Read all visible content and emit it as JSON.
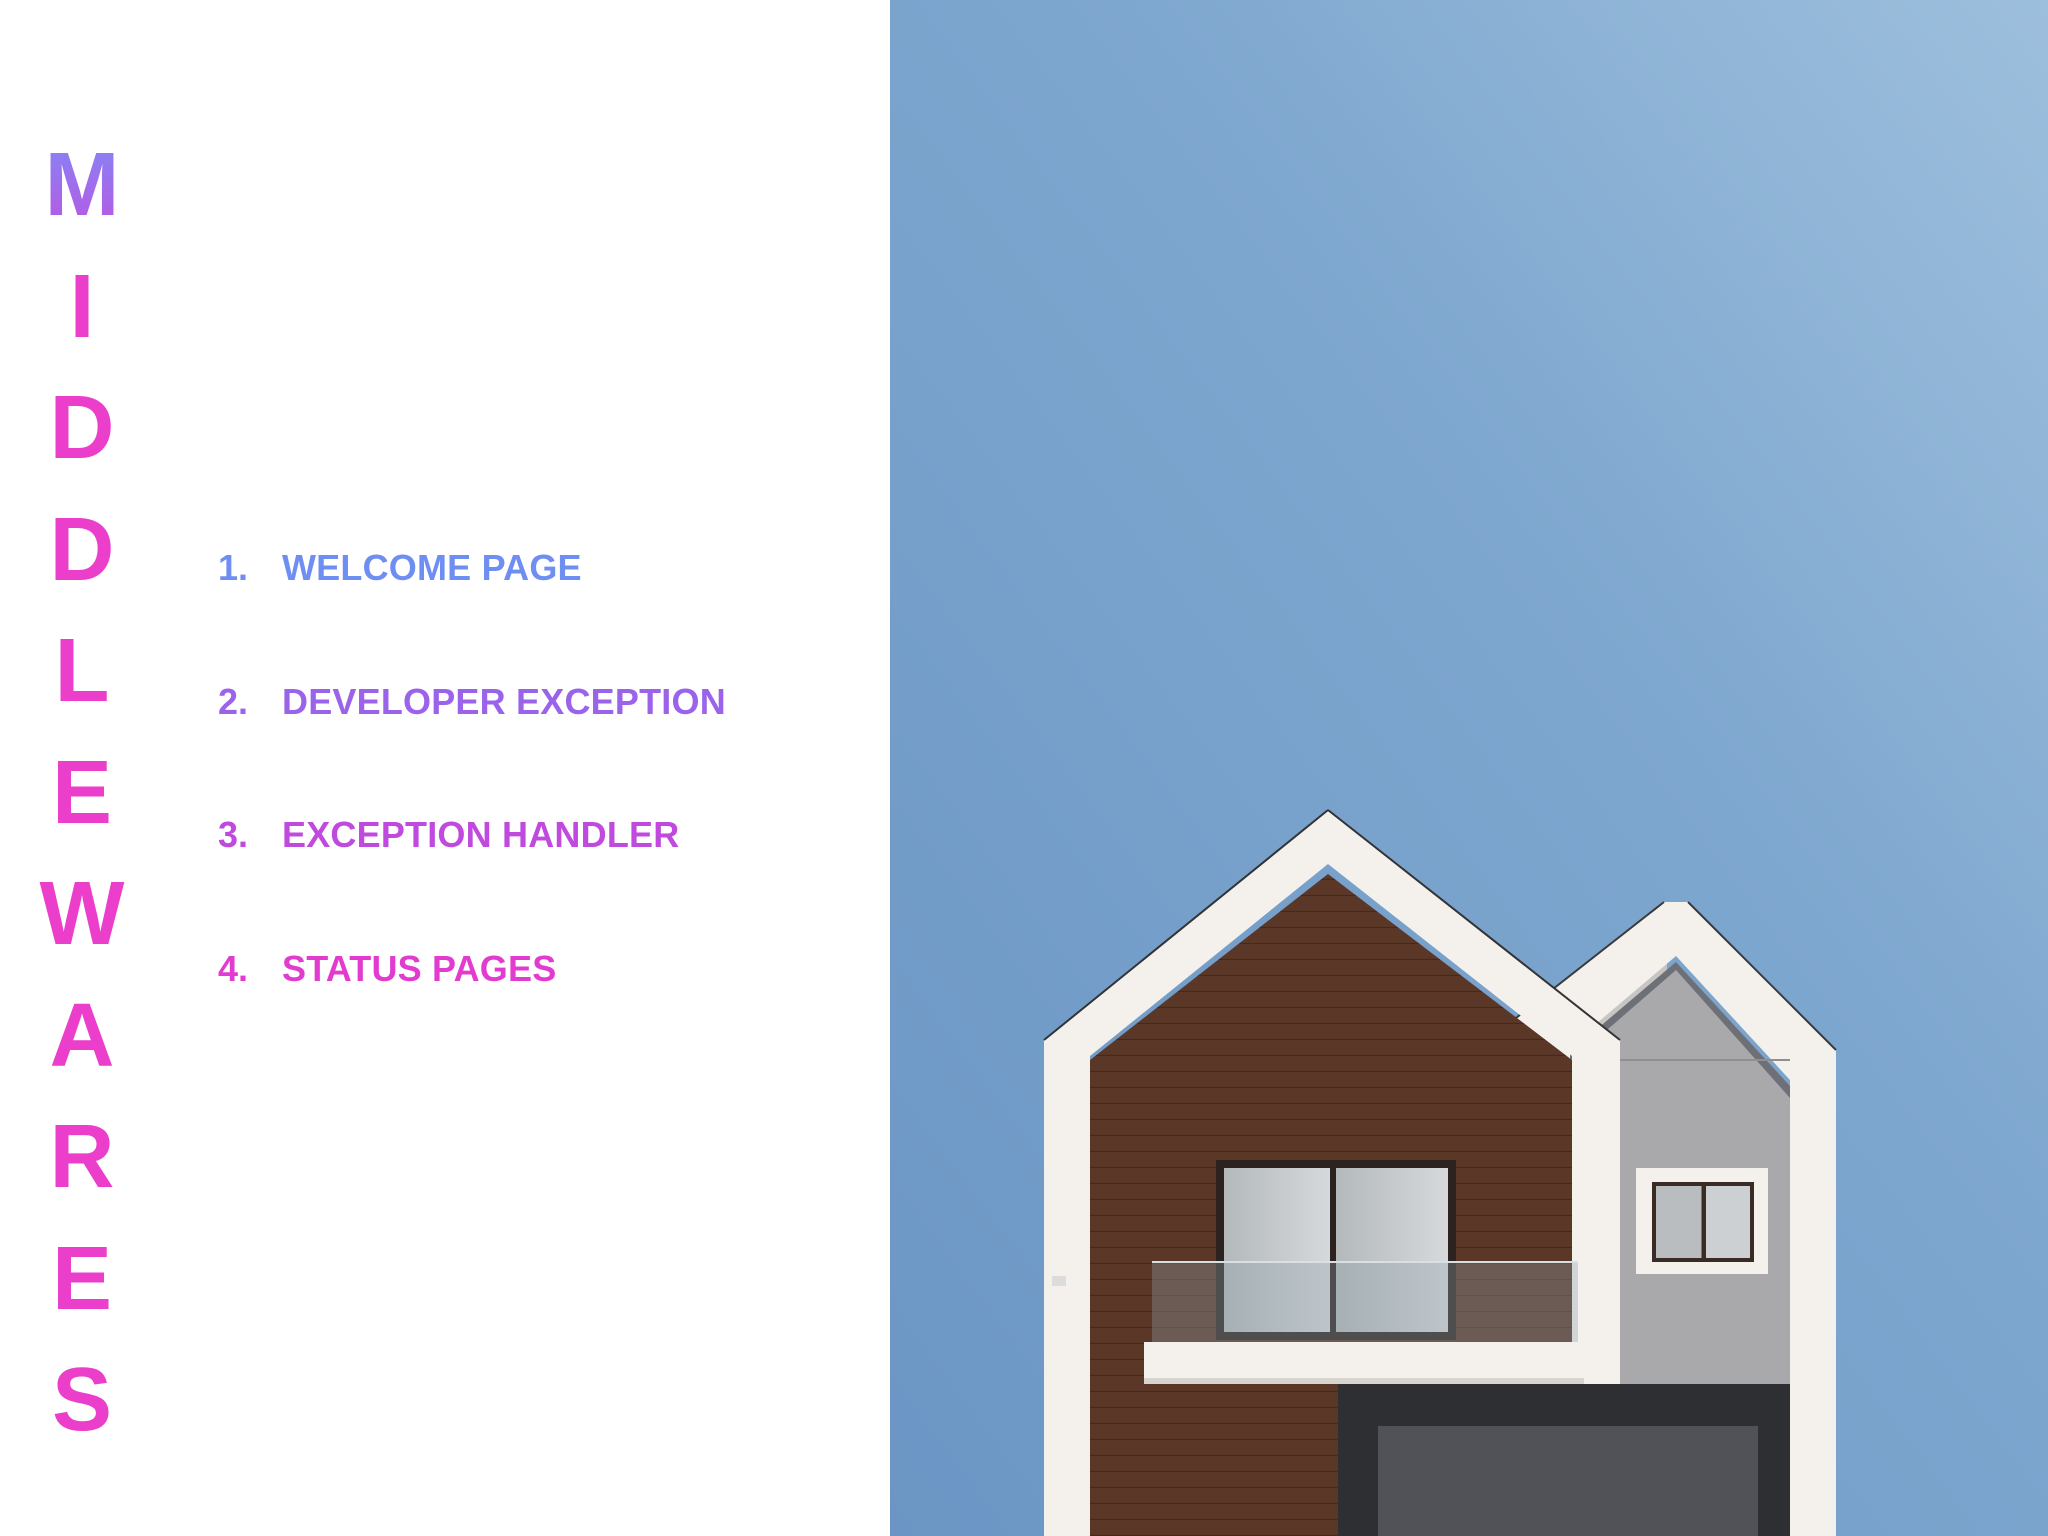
{
  "title_letters": [
    "M",
    "I",
    "D",
    "D",
    "L",
    "E",
    "W",
    "A",
    "R",
    "E",
    "S"
  ],
  "menu": [
    {
      "number": "1.",
      "label": "WELCOME PAGE",
      "color": "#6f8ef2"
    },
    {
      "number": "2.",
      "label": "DEVELOPER EXCEPTION",
      "color": "#9a63ea"
    },
    {
      "number": "3.",
      "label": "EXCEPTION HANDLER",
      "color": "#c049de"
    },
    {
      "number": "4.",
      "label": "STATUS PAGES",
      "color": "#e23bd0"
    }
  ],
  "colors": {
    "title_pink": "#ea3ecb",
    "title_gradient_start": "#7f8cf7",
    "sky": "#7aa3cd",
    "wood": "#5a3727",
    "house_trim": "#f4f1ed",
    "facade_gray": "#a8a8aa"
  }
}
